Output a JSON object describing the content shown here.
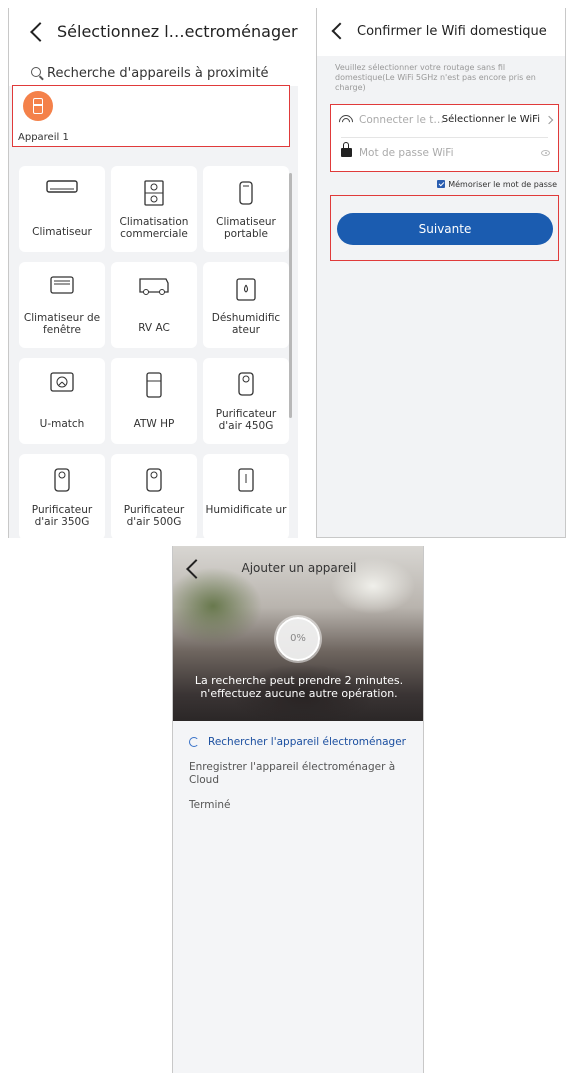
{
  "select_screen": {
    "header": {
      "title": "Sélectionnez l…ectroménager"
    },
    "search": {
      "label": "Recherche d'appareils à proximité"
    },
    "nearby_device": {
      "label": "Appareil 1"
    },
    "appliances": [
      {
        "label": "Climatiseur",
        "icon": "split-ac-icon"
      },
      {
        "label": "Climatisation commerciale",
        "icon": "commercial-ac-icon"
      },
      {
        "label": "Climatiseur portable",
        "icon": "portable-ac-icon"
      },
      {
        "label": "Climatiseur de fenêtre",
        "icon": "window-ac-icon"
      },
      {
        "label": "RV AC",
        "icon": "rv-ac-icon"
      },
      {
        "label": "Déshumidific ateur",
        "icon": "dehumidifier-icon"
      },
      {
        "label": "U-match",
        "icon": "u-match-icon"
      },
      {
        "label": "ATW HP",
        "icon": "heat-pump-icon"
      },
      {
        "label": "Purificateur d'air 450G",
        "icon": "air-purifier-icon"
      },
      {
        "label": "Purificateur d'air 350G",
        "icon": "air-purifier-icon"
      },
      {
        "label": "Purificateur d'air 500G",
        "icon": "air-purifier-icon"
      },
      {
        "label": "Humidificate ur",
        "icon": "humidifier-icon"
      }
    ]
  },
  "wifi_screen": {
    "header": {
      "title": "Confirmer le Wifi domestique"
    },
    "hint": "Veuillez sélectionner votre routage sans fil domestique(Le WiFi 5GHz n'est pas encore pris en charge)",
    "ssid_placeholder": "Connecter le t…",
    "ssid_select_label": "Sélectionner le WiFi",
    "password_placeholder": "Mot de passe WiFi",
    "remember_label": "Mémoriser le mot de passe",
    "next_button": "Suivante",
    "colors": {
      "primary": "#1b5cb0",
      "highlight": "#e03a3a"
    }
  },
  "progress_screen": {
    "header": {
      "title": "Ajouter un appareil"
    },
    "progress_text": "0%",
    "progress_value": 0,
    "message_line1": "La recherche peut prendre 2 minutes.",
    "message_line2": "n'effectuez aucune autre opération.",
    "steps": [
      {
        "label": "Rechercher l'appareil électroménager",
        "state": "active"
      },
      {
        "label": "Enregistrer l'appareil électroménager à Cloud",
        "state": "pending"
      },
      {
        "label": "Terminé",
        "state": "pending"
      }
    ]
  }
}
